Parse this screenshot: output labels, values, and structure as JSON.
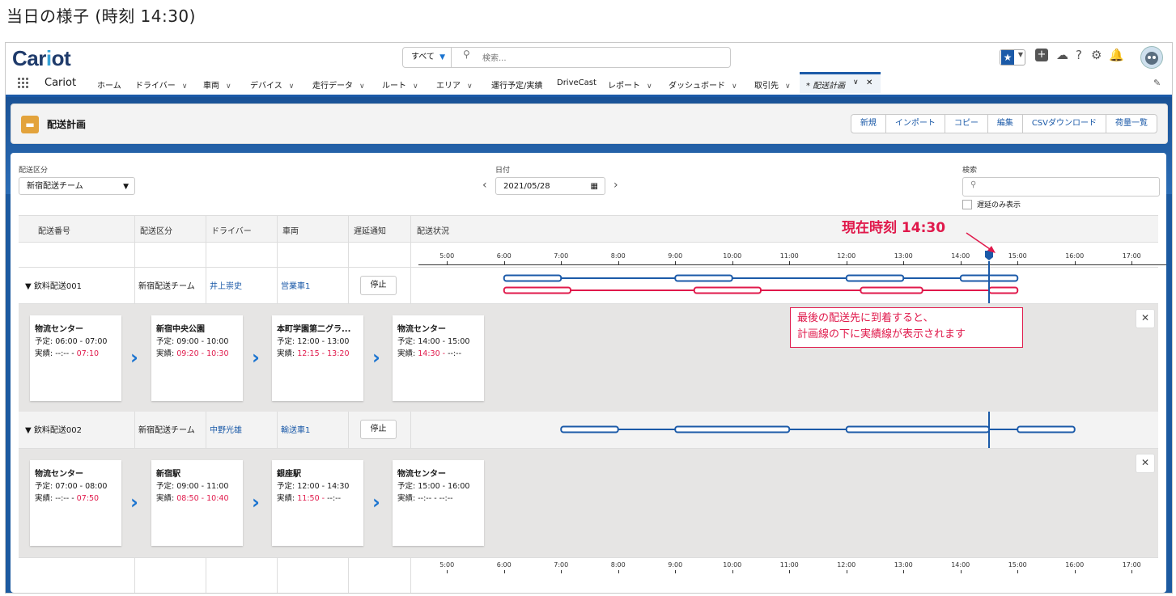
{
  "page_heading": "当日の様子 (時刻 14:30)",
  "logo": {
    "text_a": "Car",
    "text_dot": "i",
    "text_b": "ot"
  },
  "global_search": {
    "scope": "すべて",
    "placeholder": "検索..."
  },
  "app_name": "Cariot",
  "nav": [
    {
      "label": "ホーム",
      "dropdown": false
    },
    {
      "label": "ドライバー",
      "dropdown": true
    },
    {
      "label": "車両",
      "dropdown": true
    },
    {
      "label": "デバイス",
      "dropdown": true
    },
    {
      "label": "走行データ",
      "dropdown": true
    },
    {
      "label": "ルート",
      "dropdown": true
    },
    {
      "label": "エリア",
      "dropdown": true
    },
    {
      "label": "運行予定/実績",
      "dropdown": false
    },
    {
      "label": "DriveCast",
      "dropdown": false
    },
    {
      "label": "レポート",
      "dropdown": true
    },
    {
      "label": "ダッシュボード",
      "dropdown": true
    },
    {
      "label": "取引先",
      "dropdown": true
    }
  ],
  "active_tab": "* 配送計画",
  "page_header": {
    "title": "配送計画",
    "buttons": [
      "新規",
      "インポート",
      "コピー",
      "編集",
      "CSVダウンロード",
      "荷量一覧"
    ]
  },
  "filters": {
    "category_label": "配送区分",
    "category_value": "新宿配送チーム",
    "date_label": "日付",
    "date_value": "2021/05/28",
    "search_label": "検索",
    "search_placeholder": "",
    "delay_only_label": "遅延のみ表示"
  },
  "table": {
    "headers": [
      "配送番号",
      "配送区分",
      "ドライバー",
      "車両",
      "遅延通知",
      "配送状況"
    ],
    "rows": [
      {
        "no": "飲料配送001",
        "category": "新宿配送チーム",
        "driver": "井上崇史",
        "vehicle": "営業車1",
        "action": "停止"
      },
      {
        "no": "飲料配送002",
        "category": "新宿配送チーム",
        "driver": "中野光雄",
        "vehicle": "輸送車1",
        "action": "停止"
      }
    ]
  },
  "timeline": {
    "ticks": [
      "5:00",
      "6:00",
      "7:00",
      "8:00",
      "9:00",
      "10:00",
      "11:00",
      "12:00",
      "13:00",
      "14:00",
      "15:00",
      "16:00",
      "17:00"
    ],
    "current_time": "14:30",
    "colors": {
      "plan": "#1b5aa8",
      "actual": "#e0194b"
    },
    "row1_plan": [
      [
        "6:00",
        "7:00"
      ],
      [
        "9:00",
        "10:00"
      ],
      [
        "12:00",
        "13:00"
      ],
      [
        "14:00",
        "15:00"
      ]
    ],
    "row1_actual": [
      [
        "6:00",
        "7:10"
      ],
      [
        "9:20",
        "10:30"
      ],
      [
        "12:15",
        "13:20"
      ],
      [
        "14:30",
        "15:00"
      ]
    ],
    "row2_plan": [
      [
        "7:00",
        "8:00"
      ],
      [
        "9:00",
        "11:00"
      ],
      [
        "12:00",
        "14:30"
      ],
      [
        "15:00",
        "16:00"
      ]
    ]
  },
  "details": [
    {
      "stops": [
        {
          "name": "物流センター",
          "plan_label": "予定:",
          "plan": "06:00 - 07:00",
          "act_label": "実績:",
          "act_start": "--:--",
          "act_sep": "-",
          "act_end": "07:10"
        },
        {
          "name": "新宿中央公園",
          "plan_label": "予定:",
          "plan": "09:00 - 10:00",
          "act_label": "実績:",
          "act_start": "09:20",
          "act_sep": "-",
          "act_end": "10:30"
        },
        {
          "name": "本町学園第二グラ...",
          "plan_label": "予定:",
          "plan": "12:00 - 13:00",
          "act_label": "実績:",
          "act_start": "12:15",
          "act_sep": "-",
          "act_end": "13:20"
        },
        {
          "name": "物流センター",
          "plan_label": "予定:",
          "plan": "14:00 - 15:00",
          "act_label": "実績:",
          "act_start": "14:30",
          "act_sep": "-",
          "act_end": "--:--"
        }
      ]
    },
    {
      "stops": [
        {
          "name": "物流センター",
          "plan_label": "予定:",
          "plan": "07:00 - 08:00",
          "act_label": "実績:",
          "act_start": "--:--",
          "act_sep": "-",
          "act_end": "07:50"
        },
        {
          "name": "新宿駅",
          "plan_label": "予定:",
          "plan": "09:00 - 11:00",
          "act_label": "実績:",
          "act_start": "08:50",
          "act_sep": "-",
          "act_end": "10:40"
        },
        {
          "name": "銀座駅",
          "plan_label": "予定:",
          "plan": "12:00 - 14:30",
          "act_label": "実績:",
          "act_start": "11:50",
          "act_sep": "-",
          "act_end": "--:--"
        },
        {
          "name": "物流センター",
          "plan_label": "予定:",
          "plan": "15:00 - 16:00",
          "act_label": "実績:",
          "act_start": "--:--",
          "act_sep": "-",
          "act_end": "--:--"
        }
      ]
    }
  ],
  "annotations": {
    "now_label": "現在時刻 14:30",
    "note_line1": "最後の配送先に到着すると、",
    "note_line2": "計画線の下に実績線が表示されます"
  }
}
